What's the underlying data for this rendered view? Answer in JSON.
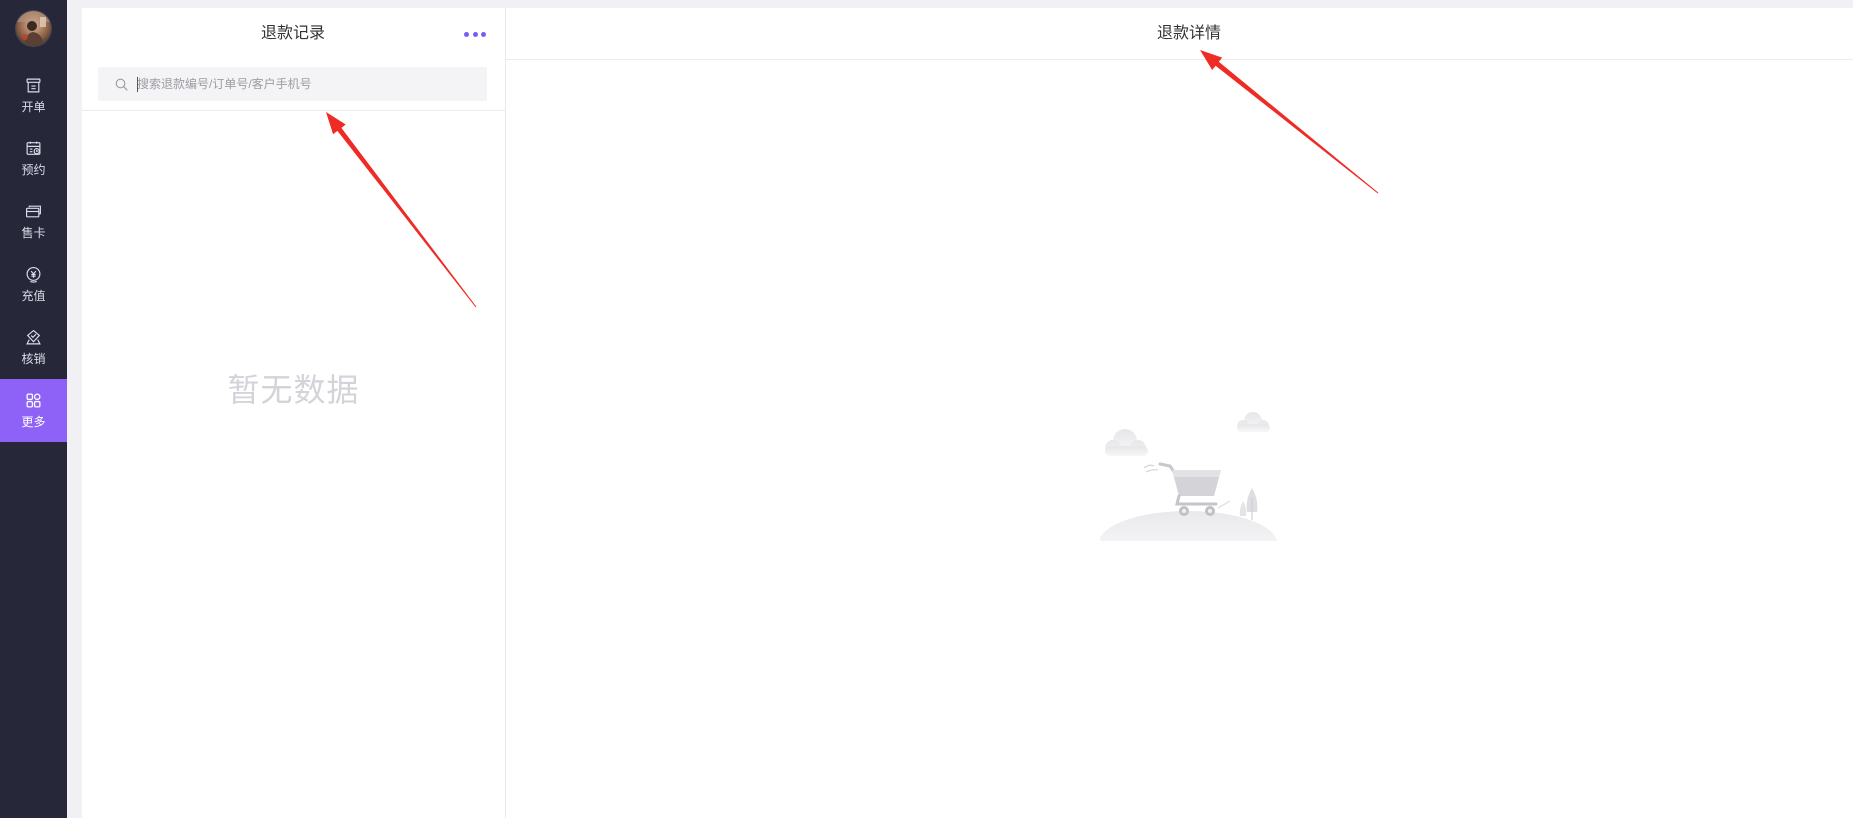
{
  "sidebar": {
    "avatar_icon": "avatar",
    "items": [
      {
        "label": "开单",
        "icon": "receipt-icon"
      },
      {
        "label": "预约",
        "icon": "calendar-icon"
      },
      {
        "label": "售卡",
        "icon": "card-icon"
      },
      {
        "label": "充值",
        "icon": "yuan-coin-icon"
      },
      {
        "label": "核销",
        "icon": "ticket-check-icon"
      },
      {
        "label": "更多",
        "icon": "grid-icon",
        "active": true
      }
    ]
  },
  "left_panel": {
    "title": "退款记录",
    "more_icon": "more-dots-icon",
    "search": {
      "icon": "search-icon",
      "placeholder": "搜索退款编号/订单号/客户手机号"
    },
    "empty_text": "暂无数据"
  },
  "right_panel": {
    "title": "退款详情",
    "empty_illustration": "empty-cart-illustration"
  },
  "colors": {
    "accent": "#8f62f7",
    "sidebar_bg": "#27273a",
    "page_bg": "#f0f0f5",
    "annotation_arrow": "#ee2b24"
  }
}
